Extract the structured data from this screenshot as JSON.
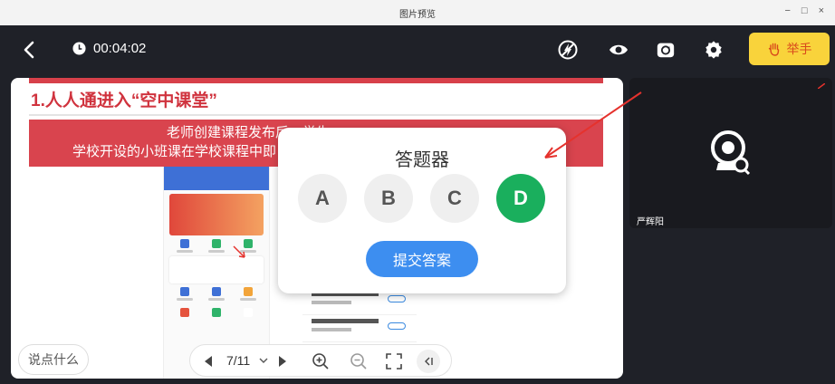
{
  "window": {
    "title": "图片预览",
    "min": "−",
    "max": "□",
    "close": "×"
  },
  "topbar": {
    "timer": "00:04:02",
    "raise_hand_label": "举手"
  },
  "slide": {
    "heading": "1.人人通进入“空中课堂”",
    "band_line1": "老师创建课程发布后，学生",
    "band_line2": "学校开设的小班课在学校课程中即"
  },
  "answer_panel": {
    "title": "答题器",
    "options": [
      "A",
      "B",
      "C",
      "D"
    ],
    "selected": "D",
    "submit_label": "提交答案"
  },
  "chat": {
    "placeholder": "说点什么"
  },
  "pager": {
    "page": "7/11"
  },
  "video": {
    "participant_name": "严辉阳"
  },
  "colors": {
    "accent_green": "#1aaf5d",
    "submit_blue": "#3d8ef0",
    "raise_yellow": "#f9d33b",
    "annotation_red": "#e5322d"
  }
}
